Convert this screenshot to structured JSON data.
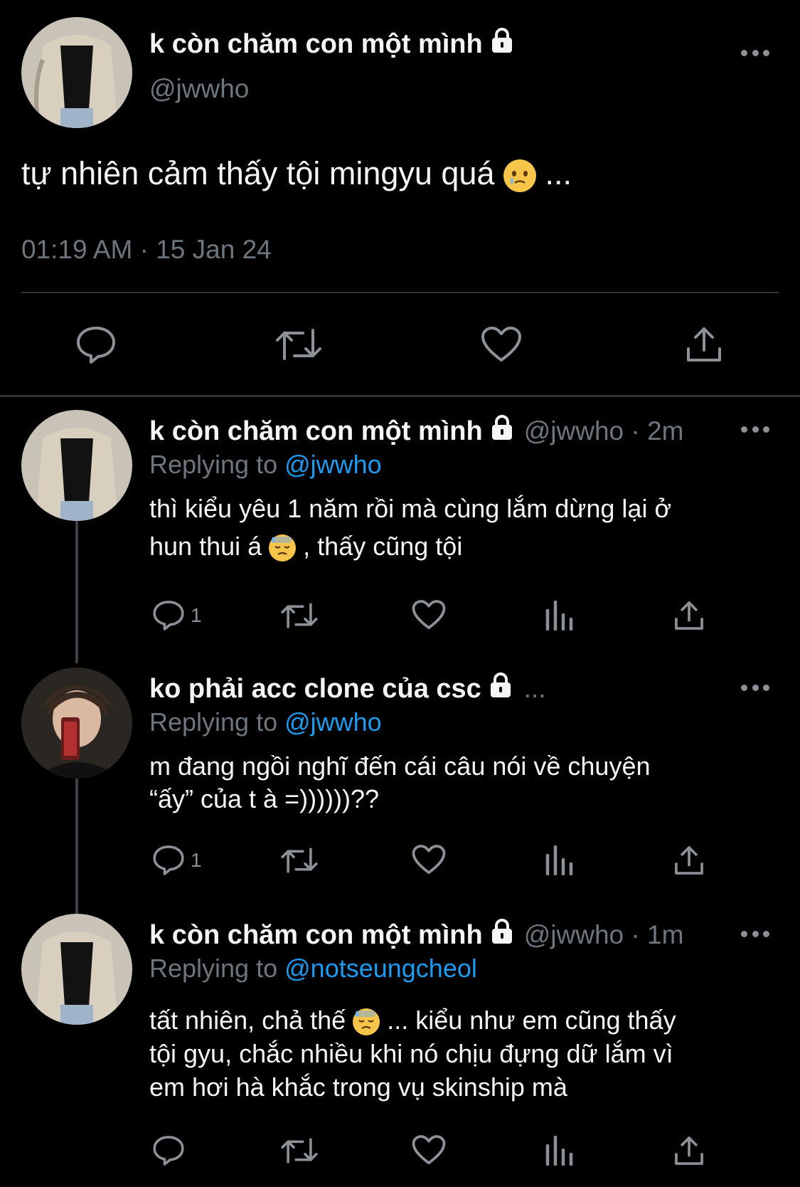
{
  "main_tweet": {
    "display_name": "k còn chăm con một mình",
    "handle": "@jwwho",
    "text_before": "tự nhiên cảm thấy tội mingyu quá",
    "text_after": "...",
    "emoji": "face-holding-back-tears",
    "timestamp": "01:19 AM · 15 Jan 24"
  },
  "replies": [
    {
      "display_name": "k còn chăm con một mình",
      "handle_time": "@jwwho · 2m",
      "replying_prefix": "Replying to",
      "replying_to": "@jwwho",
      "line1": "thì kiểu yêu 1 năm rồi mà cùng lắm dừng lại ở",
      "line2_before": "hun thui á",
      "line2_after": ", thấy cũng tội",
      "emoji": "downcast-face-with-sweat",
      "reply_count": "1"
    },
    {
      "display_name": "ko phải acc clone của csc",
      "handle_time": "...",
      "replying_prefix": "Replying to",
      "replying_to": "@jwwho",
      "line1": "m đang ngồi nghĩ đến cái câu nói về chuyện",
      "line2": "“ấy” của t à =))))))??",
      "reply_count": "1"
    },
    {
      "display_name": "k còn chăm con một mình",
      "handle_time": "@jwwho · 1m",
      "replying_prefix": "Replying to",
      "replying_to": "@notseungcheol",
      "line1_before": "tất nhiên, chả thế",
      "line1_after": "... kiểu như em cũng thấy",
      "line2": "tội gyu, chắc nhiều khi nó chịu đựng dữ lắm vì",
      "line3": "em hơi hà khắc trong vụ skinship mà",
      "emoji": "downcast-face-with-sweat"
    }
  ],
  "colors": {
    "background": "#000000",
    "text": "#f5f5f5",
    "secondary": "#6e767d",
    "link": "#1d9bf0",
    "divider": "#2f3336"
  }
}
